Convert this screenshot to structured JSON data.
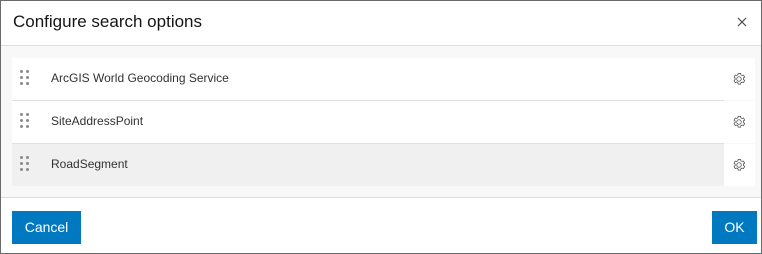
{
  "dialog": {
    "title": "Configure search options",
    "close_icon": "close-icon"
  },
  "sources": [
    {
      "label": "ArcGIS World Geocoding Service",
      "drag_icon": "drag-handle-icon",
      "settings_icon": "gear-icon"
    },
    {
      "label": "SiteAddressPoint",
      "drag_icon": "drag-handle-icon",
      "settings_icon": "gear-icon"
    },
    {
      "label": "RoadSegment",
      "drag_icon": "drag-handle-icon",
      "settings_icon": "gear-icon"
    }
  ],
  "footer": {
    "cancel_label": "Cancel",
    "ok_label": "OK"
  },
  "colors": {
    "accent": "#0079c1",
    "hover_row": "#f0f0f0",
    "border": "#dcdcdc"
  }
}
